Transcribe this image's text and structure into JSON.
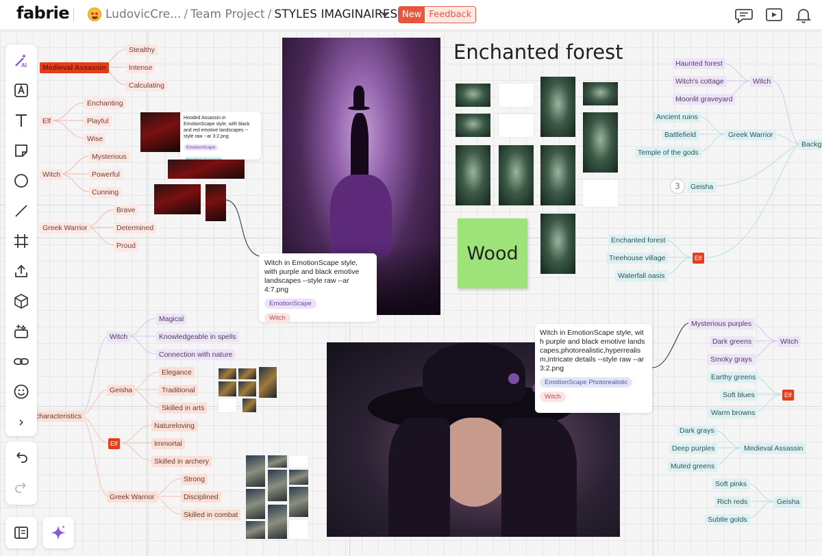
{
  "header": {
    "logo": "fabrie",
    "user": "LudovicCre...",
    "project": "Team Project",
    "board": "STYLES IMAGINAIRES",
    "badge_new": "New",
    "badge_feedback": "Feedback"
  },
  "colors": {
    "accent": "#e8563e",
    "branch_red": "#f0a090",
    "branch_purple": "#c9b0e6",
    "branch_teal": "#a9dcdc",
    "branch_orange": "#f2b3a0",
    "sticky": "#9ee27a"
  },
  "toolbar": {
    "icons": [
      "ai-magic-icon",
      "text-style-icon",
      "text-icon",
      "sticky-note-icon",
      "ellipse-icon",
      "line-icon",
      "frame-icon",
      "upload-icon",
      "3d-box-icon",
      "generate-image-icon",
      "link-icon",
      "emoji-icon",
      "expand-icon"
    ],
    "ai_label": "AI",
    "expand": "›"
  },
  "mindmap_top_left": {
    "medieval": {
      "label": "Medieval Assassin",
      "children": [
        "Stealthy",
        "Intense",
        "Calculating"
      ]
    },
    "elf": {
      "label": "Elf",
      "children": [
        "Enchanting",
        "Playful",
        "Wise"
      ]
    },
    "witch": {
      "label": "Witch",
      "children": [
        "Mysterious",
        "Powerful",
        "Cunning"
      ]
    },
    "greek": {
      "label": "Greek Warrior",
      "children": [
        "Brave",
        "Determined",
        "Proud"
      ]
    }
  },
  "mindmap_bottom_left": {
    "root": "characteristics",
    "witch": {
      "label": "Witch",
      "children": [
        "Magical",
        "Knowledgeable in spells",
        "Connection with nature"
      ]
    },
    "geisha": {
      "label": "Geisha",
      "children": [
        "Elegance",
        "Traditional",
        "Skilled in arts"
      ]
    },
    "elf": {
      "label": "Elf",
      "children": [
        "Natureloving",
        "Immortal",
        "Skilled in archery"
      ]
    },
    "greek": {
      "label": "Greek Warrior",
      "children": [
        "Strong",
        "Disciplined",
        "Skilled in combat"
      ]
    }
  },
  "mindmap_right_top": {
    "witch": {
      "label": "Witch",
      "children": [
        "Haunted forest",
        "Witch's cottage",
        "Moonlit graveyard"
      ]
    },
    "greek": {
      "label": "Greek Warrior",
      "children": [
        "Ancient ruins",
        "Battlefield",
        "Temple of the gods"
      ]
    },
    "geisha": {
      "label": "Geisha",
      "count": "3"
    },
    "elf": {
      "label": "Elf",
      "children": [
        "Enchanted forest",
        "Treehouse village",
        "Waterfall oasis"
      ]
    },
    "root": "Backgr"
  },
  "mindmap_right_bottom": {
    "witch": {
      "label": "Witch",
      "children": [
        "Mysterious purples",
        "Dark greens",
        "Smoky grays"
      ]
    },
    "elf": {
      "label": "Elf",
      "children": [
        "Earthy greens",
        "Soft blues",
        "Warm browns"
      ]
    },
    "medieval": {
      "label": "Medieval Assassin",
      "children": [
        "Dark grays",
        "Deep purples",
        "Muted greens"
      ]
    },
    "geisha": {
      "label": "Geisha",
      "children": [
        "Soft pinks",
        "Rich reds",
        "Subtle golds"
      ]
    }
  },
  "cards": {
    "hooded": {
      "text": "Hooded Assassin in EmotionScape style, with black and red emotive landscapes --style raw --ar 3:2.png",
      "tags": [
        "EmotionScape",
        "Hooded Assassin"
      ]
    },
    "witch1": {
      "text": "Witch in EmotionScape style, with purple and black emotive landscapes --style raw --ar 4:7.png",
      "tags": [
        "EmotionScape",
        "Witch"
      ]
    },
    "witch2": {
      "text": "Witch in EmotionScape style, with purple and black emotive landscapes,photorealistic,hyperrealism,intricate details --style raw --ar 3:2.png",
      "tags": [
        "EmotionScape Photorealistic",
        "Witch"
      ]
    }
  },
  "board": {
    "title": "Enchanted forest",
    "sticky": "Wood"
  }
}
